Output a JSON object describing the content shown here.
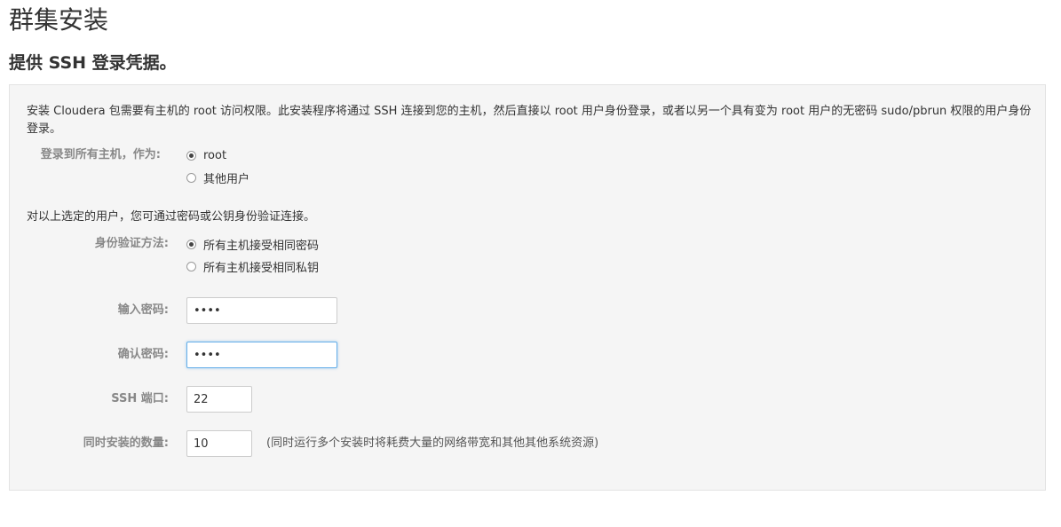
{
  "header": {
    "title": "群集安装",
    "subtitle": "提供 SSH 登录凭据。"
  },
  "panel": {
    "intro": "安装 Cloudera 包需要有主机的 root 访问权限。此安装程序将通过 SSH 连接到您的主机，然后直接以 root 用户身份登录，或者以另一个具有变为 root 用户的无密码 sudo/pbrun 权限的用户身份登录。",
    "login_as": {
      "label": "登录到所有主机，作为:",
      "options": [
        {
          "label": "root",
          "checked": true
        },
        {
          "label": "其他用户",
          "checked": false
        }
      ]
    },
    "auth_intro": "对以上选定的用户，您可通过密码或公钥身份验证连接。",
    "auth_method": {
      "label": "身份验证方法:",
      "options": [
        {
          "label": "所有主机接受相同密码",
          "checked": true
        },
        {
          "label": "所有主机接受相同私钥",
          "checked": false
        }
      ]
    },
    "password": {
      "label": "输入密码:",
      "value": "••••"
    },
    "confirm_password": {
      "label": "确认密码:",
      "value": "••••"
    },
    "ssh_port": {
      "label": "SSH 端口:",
      "value": "22"
    },
    "simultaneous_installs": {
      "label": "同时安装的数量:",
      "value": "10",
      "hint": "(同时运行多个安装时将耗费大量的网络带宽和其他其他系统资源)"
    }
  }
}
